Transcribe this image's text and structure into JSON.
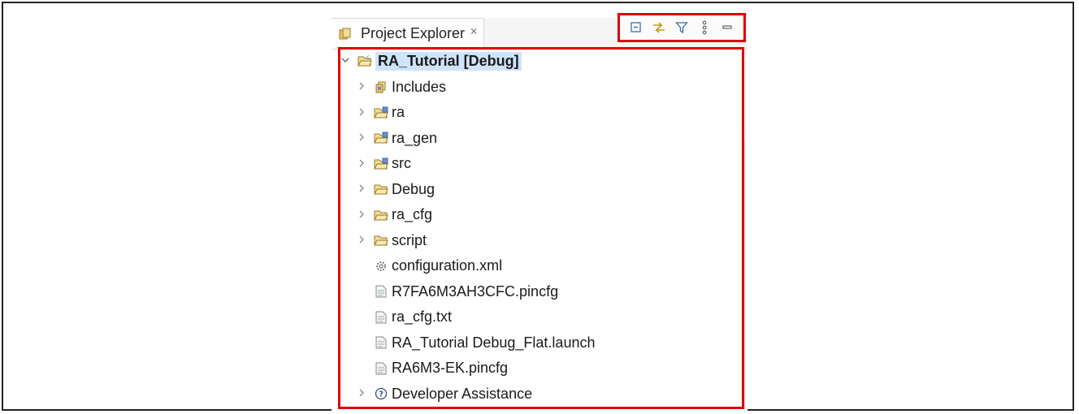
{
  "explorer": {
    "tab_title": "Project Explorer",
    "tab_close_glyph": "⨯",
    "toolbar": [
      {
        "name": "collapse-all-icon",
        "icon": "collapse-all"
      },
      {
        "name": "link-with-editor-icon",
        "icon": "link-with-editor"
      },
      {
        "name": "filter-icon",
        "icon": "filter"
      },
      {
        "name": "view-menu-icon",
        "icon": "kebab-menu"
      },
      {
        "name": "minimize-icon",
        "icon": "minimize"
      }
    ]
  },
  "tree": {
    "root": {
      "label": "RA_Tutorial [Debug]",
      "icon": "project-folder-icon",
      "expanded": true
    },
    "items": [
      {
        "label": "Includes",
        "icon": "includes-icon",
        "expandable": true
      },
      {
        "label": "ra",
        "icon": "source-folder-icon",
        "expandable": true
      },
      {
        "label": "ra_gen",
        "icon": "source-folder-icon",
        "expandable": true
      },
      {
        "label": "src",
        "icon": "source-folder-icon",
        "expandable": true
      },
      {
        "label": "Debug",
        "icon": "folder-icon",
        "expandable": true
      },
      {
        "label": "ra_cfg",
        "icon": "folder-icon",
        "expandable": true
      },
      {
        "label": "script",
        "icon": "folder-icon",
        "expandable": true
      },
      {
        "label": "configuration.xml",
        "icon": "gear-file-icon",
        "expandable": false
      },
      {
        "label": "R7FA6M3AH3CFC.pincfg",
        "icon": "file-icon",
        "expandable": false
      },
      {
        "label": "ra_cfg.txt",
        "icon": "file-icon",
        "expandable": false
      },
      {
        "label": "RA_Tutorial Debug_Flat.launch",
        "icon": "file-icon",
        "expandable": false
      },
      {
        "label": "RA6M3-EK.pincfg",
        "icon": "file-icon",
        "expandable": false
      },
      {
        "label": "Developer Assistance",
        "icon": "help-icon",
        "expandable": true
      }
    ]
  },
  "colors": {
    "highlight": "#e00000",
    "selection": "#cfe3fa"
  }
}
